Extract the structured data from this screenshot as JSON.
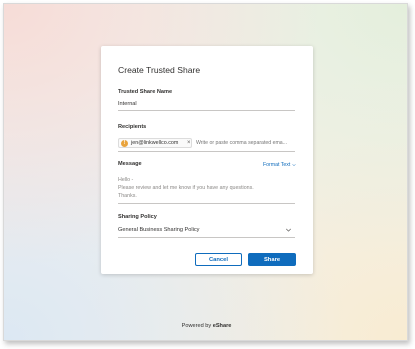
{
  "dialog": {
    "title": "Create Trusted Share",
    "name_label": "Trusted Share Name",
    "name_value": "Internal",
    "recipients_label": "Recipients",
    "recipient_chip": {
      "initial": "!",
      "email": "jen@linkwellco.com",
      "remove_glyph": "×"
    },
    "recipients_placeholder": "Write or paste comma separated ema...",
    "message_label": "Message",
    "format_text_label": "Format Text",
    "message_lines": [
      "Hello -",
      "Please review and let me know if you have any questions.",
      "Thanks."
    ],
    "policy_label": "Sharing Policy",
    "policy_value": "General Business Sharing Policy",
    "cancel_label": "Cancel",
    "share_label": "Share"
  },
  "footer": {
    "prefix": "Powered by",
    "brand": "eShare"
  },
  "icons": {
    "format_chevron": "chevron-down-icon",
    "policy_chevron": "chevron-down-icon",
    "remove_recipient": "close-icon",
    "recipient_avatar": "warning-avatar-icon"
  },
  "colors": {
    "accent": "#0f6cbd",
    "avatar": "#e8a33d"
  }
}
